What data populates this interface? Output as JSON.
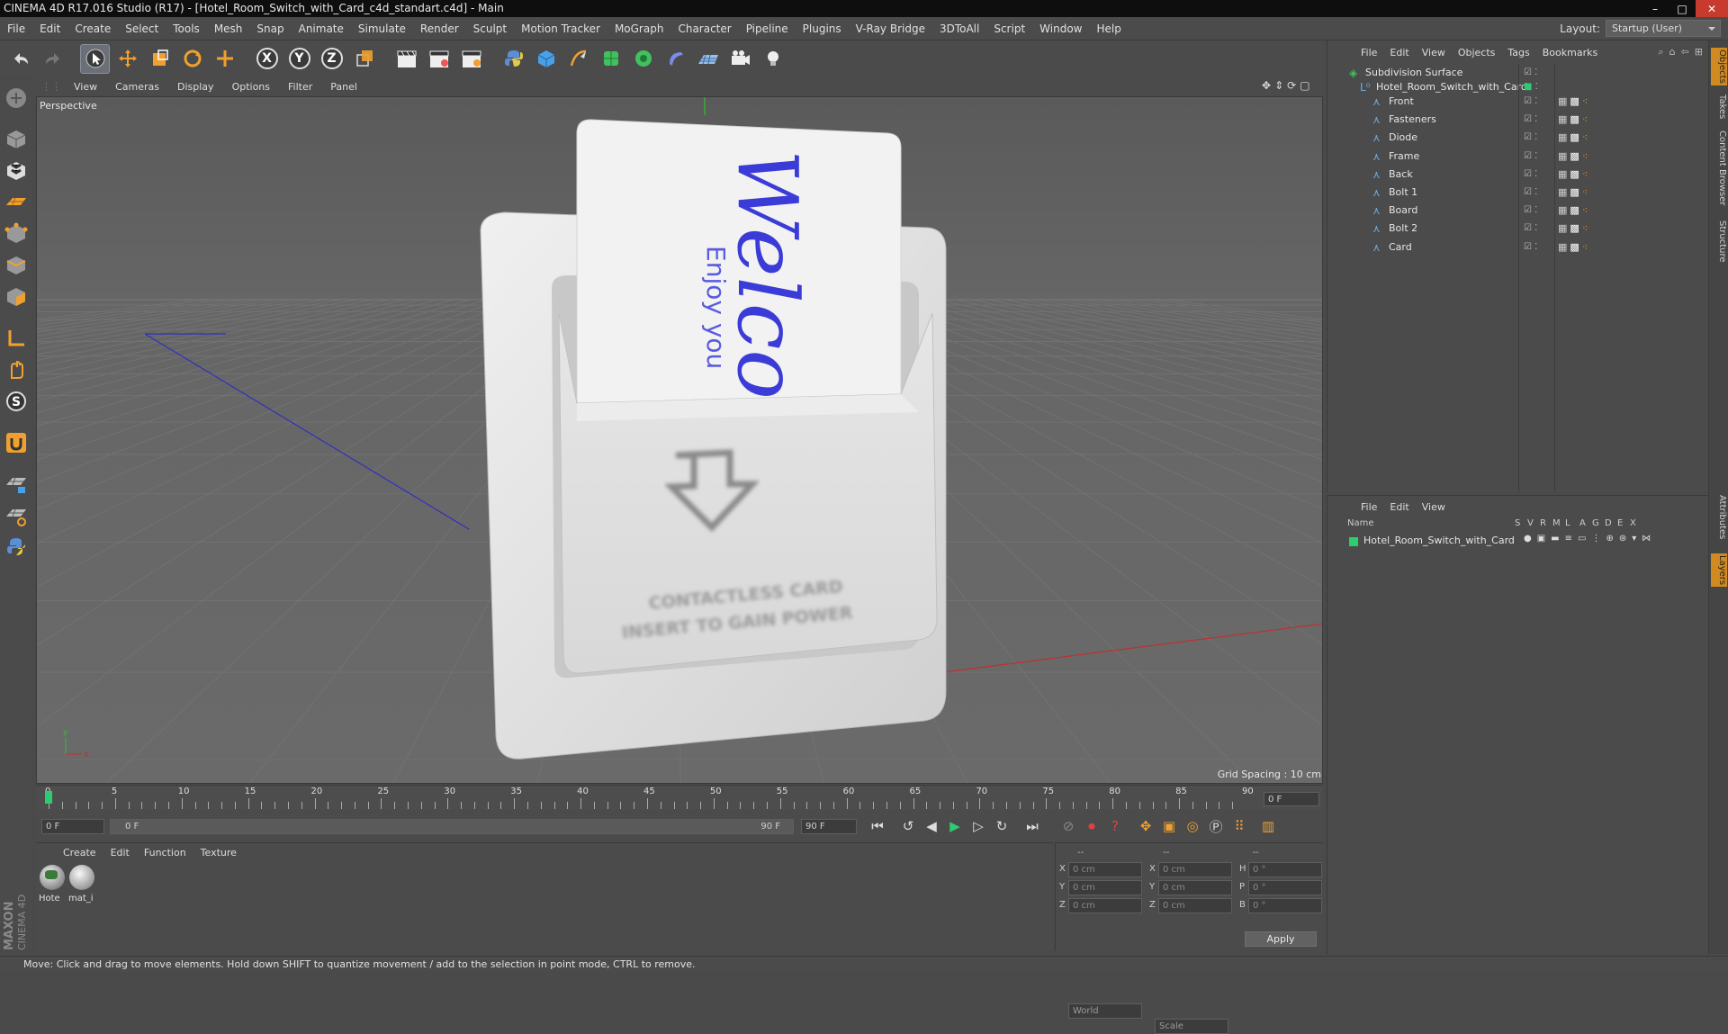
{
  "window": {
    "title": "CINEMA 4D R17.016 Studio (R17) - [Hotel_Room_Switch_with_Card_c4d_standart.c4d] - Main",
    "controls": [
      "–",
      "□",
      "✕"
    ]
  },
  "menubar": {
    "items": [
      "File",
      "Edit",
      "Create",
      "Select",
      "Tools",
      "Mesh",
      "Snap",
      "Animate",
      "Simulate",
      "Render",
      "Sculpt",
      "Motion Tracker",
      "MoGraph",
      "Character",
      "Pipeline",
      "Plugins",
      "V-Ray Bridge",
      "3DToAll",
      "Script",
      "Window",
      "Help"
    ],
    "layout_label": "Layout:",
    "layout_value": "Startup (User)"
  },
  "toolbar": {
    "axes": [
      "X",
      "Y",
      "Z"
    ]
  },
  "viewport": {
    "menu": [
      "View",
      "Cameras",
      "Display",
      "Options",
      "Filter",
      "Panel"
    ],
    "camera_label": "Perspective",
    "grid_spacing": "Grid Spacing : 10 cm",
    "card_text_big": "Welco",
    "card_text_small": "Enjoy you",
    "switch_text_1": "CONTACTLESS CARD",
    "switch_text_2": "INSERT TO GAIN POWER"
  },
  "timeline": {
    "ticks": [
      "0",
      "5",
      "10",
      "15",
      "20",
      "25",
      "30",
      "35",
      "40",
      "45",
      "50",
      "55",
      "60",
      "65",
      "70",
      "75",
      "80",
      "85",
      "90"
    ],
    "frame_field": "0 F",
    "current_frame": "0 F",
    "range_start": "0 F",
    "range_end": "90 F",
    "range_field_end": "90 F",
    "range_start_small": "0 F"
  },
  "materials": {
    "menu": [
      "Create",
      "Edit",
      "Function",
      "Texture"
    ],
    "items": [
      {
        "label": "Hote"
      },
      {
        "label": "mat_i"
      }
    ]
  },
  "coords": {
    "header": [
      "--",
      "--",
      "--"
    ],
    "rows": [
      {
        "a": "X",
        "av": "0 cm",
        "b": "X",
        "bv": "0 cm",
        "c": "H",
        "cv": "0 °"
      },
      {
        "a": "Y",
        "av": "0 cm",
        "b": "Y",
        "bv": "0 cm",
        "c": "P",
        "cv": "0 °"
      },
      {
        "a": "Z",
        "av": "0 cm",
        "b": "Z",
        "bv": "0 cm",
        "c": "B",
        "cv": "0 °"
      }
    ],
    "mode1": "World",
    "mode2": "Scale",
    "apply": "Apply"
  },
  "objects": {
    "menu": [
      "File",
      "Edit",
      "View",
      "Objects",
      "Tags",
      "Bookmarks"
    ],
    "root": "Subdivision Surface",
    "group": "Hotel_Room_Switch_with_Card",
    "children": [
      "Front",
      "Fasteners",
      "Diode",
      "Frame",
      "Back",
      "Bolt 1",
      "Board",
      "Bolt 2",
      "Card"
    ]
  },
  "layers": {
    "menu": [
      "File",
      "Edit",
      "View"
    ],
    "columns": [
      "Name",
      "S",
      "V",
      "R",
      "M",
      "L",
      "A",
      "G",
      "D",
      "E",
      "X"
    ],
    "rows": [
      "Hotel_Room_Switch_with_Card"
    ]
  },
  "right_tabs": [
    "Objects",
    "Takes",
    "Content Browser",
    "Structure",
    "Attributes",
    "Layers"
  ],
  "status": "Move: Click and drag to move elements. Hold down SHIFT to quantize movement / add to the selection in point mode, CTRL to remove.",
  "colors": {
    "accent_green": "#2ecc71",
    "viewport_bg": "#5d5d5d",
    "card_blue": "#3b3bd8"
  }
}
